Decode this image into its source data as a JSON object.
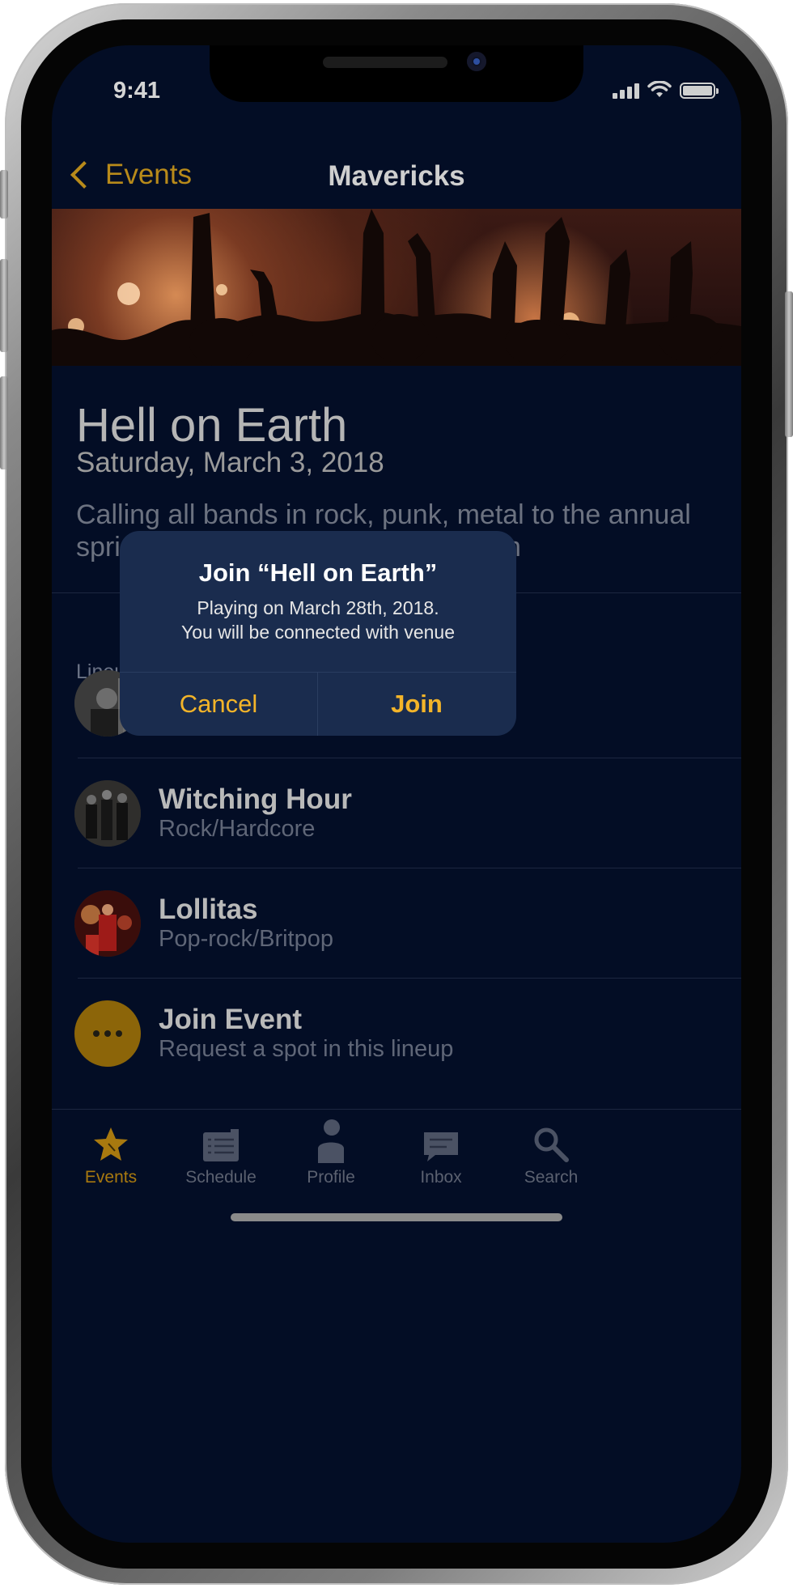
{
  "status_bar": {
    "time": "9:41"
  },
  "nav": {
    "back_label": "Events",
    "title": "Mavericks"
  },
  "event": {
    "title": "Hell on Earth",
    "date": "Saturday, March 3, 2018",
    "description": "Calling all bands in rock, punk, metal to the annual spring time show Night Rock. Lookin"
  },
  "lineup": {
    "label": "Lineup",
    "bands": [
      {
        "name": "Witching Hour",
        "genre": "Rock/Hardcore"
      },
      {
        "name": "Lollitas",
        "genre": "Pop-rock/Britpop"
      }
    ],
    "join": {
      "title": "Join Event",
      "subtitle": "Request a spot in this lineup"
    }
  },
  "alert": {
    "title": "Join “Hell on Earth”",
    "message_line1": "Playing on March 28th, 2018.",
    "message_line2": "You will be connected with venue",
    "cancel_label": "Cancel",
    "join_label": "Join"
  },
  "tabs": [
    {
      "label": "Events",
      "icon": "star-icon",
      "active": true
    },
    {
      "label": "Schedule",
      "icon": "schedule-icon",
      "active": false
    },
    {
      "label": "Profile",
      "icon": "profile-icon",
      "active": false
    },
    {
      "label": "Inbox",
      "icon": "inbox-icon",
      "active": false
    },
    {
      "label": "Search",
      "icon": "search-icon",
      "active": false
    }
  ],
  "colors": {
    "background": "#030d25",
    "accent": "#f3b429",
    "alert_background": "#1a2c4e"
  }
}
